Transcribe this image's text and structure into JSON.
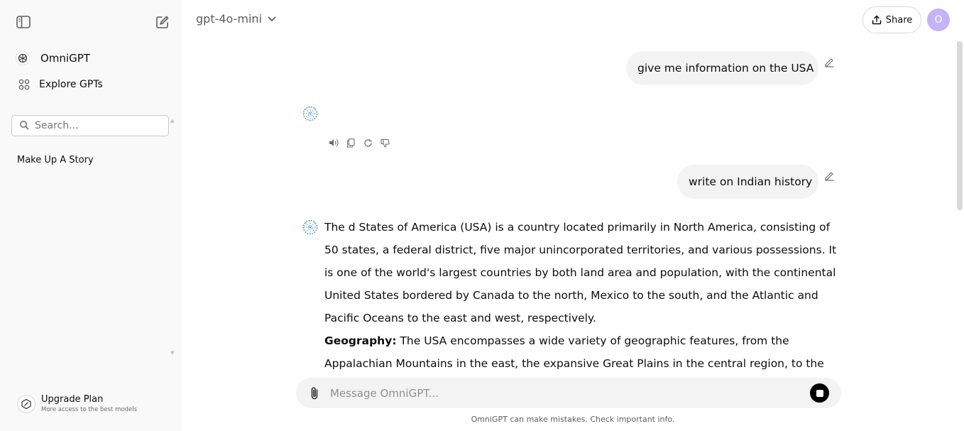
{
  "sidebar": {
    "brand_label": "OmniGPT",
    "explore_label": "Explore GPTs",
    "search_placeholder": "Search...",
    "chats": [
      {
        "title": "Make Up A Story"
      }
    ],
    "upgrade": {
      "title": "Upgrade Plan",
      "subtitle": "More access to the best models"
    }
  },
  "header": {
    "model": "gpt-4o-mini",
    "share_label": "Share",
    "avatar_initial": "O",
    "avatar_color": "#c2b4f6"
  },
  "conversation": {
    "user_messages": [
      "give me information on the USA",
      "write on Indian history"
    ],
    "answer": {
      "paragraph1": "The d States of America (USA) is a country located primarily in North America, consisting of 50 states, a federal district, five major unincorporated territories, and various possessions. It is one of the world's largest countries by both land area and population, with the continental United States bordered by Canada to the north, Mexico to the south, and the Atlantic and Pacific Oceans to the east and west, respectively.",
      "geo_heading": "Geography:",
      "geo_text": " The USA encompasses a wide variety of geographic features, from the Appalachian Mountains in the east, the expansive Great Plains in the central region, to the Rocky Mountains"
    }
  },
  "composer": {
    "placeholder": "Message OmniGPT...",
    "disclaimer": "OmniGPT can make mistakes. Check important info."
  },
  "icons": {
    "sidebar_toggle": "sidebar-toggle-icon",
    "new_chat": "new-chat-icon",
    "brand": "omnigpt-logo-icon",
    "explore": "grid-icon",
    "search": "search-icon",
    "upgrade": "upgrade-icon",
    "share": "upload-icon",
    "edit": "pencil-icon",
    "read_aloud": "speaker-icon",
    "copy": "copy-icon",
    "regenerate": "refresh-icon",
    "dislike": "thumbs-down-icon",
    "attach": "paperclip-icon",
    "stop": "stop-icon"
  }
}
